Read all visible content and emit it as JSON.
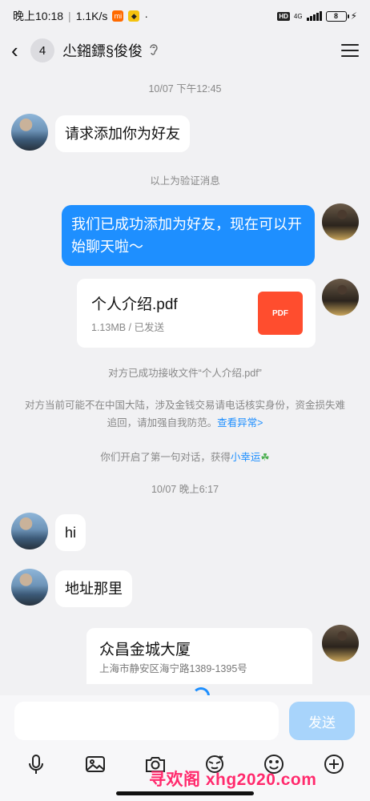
{
  "status": {
    "time": "晚上10:18",
    "speed": "1.1K/s",
    "hd": "HD",
    "network": "4G",
    "battery": "8"
  },
  "header": {
    "unread_count": "4",
    "contact_name": "尐鎺鏢§俊俊"
  },
  "messages": {
    "time1": "10/07 下午12:45",
    "friend_request": "请求添加你为好友",
    "verify_note": "以上为验证消息",
    "added_friend": "我们已成功添加为好友，现在可以开始聊天啦～",
    "file": {
      "name": "个人介绍.pdf",
      "meta": "1.13MB / 已发送",
      "icon_label": "PDF"
    },
    "file_received": "对方已成功接收文件“个人介绍.pdf”",
    "warning_text": "对方当前可能不在中国大陆，涉及金钱交易请电话核实身份，资金损失难追回，请加强自我防范。",
    "warning_link": "查看异常>",
    "first_chat_text": "你们开启了第一句对话，获得",
    "first_chat_link": "小幸运",
    "time2": "10/07 晚上6:17",
    "hi": "hi",
    "where": "地址那里",
    "location": {
      "title": "众昌金城大厦",
      "address": "上海市静安区海宁路1389-1395号"
    }
  },
  "input": {
    "placeholder": "",
    "send_label": "发送"
  },
  "watermark": "寻欢阁 xhg2020.com",
  "colors": {
    "accent": "#1e8fff",
    "pdf": "#ff4d2e",
    "watermark": "#ff2a6d"
  }
}
